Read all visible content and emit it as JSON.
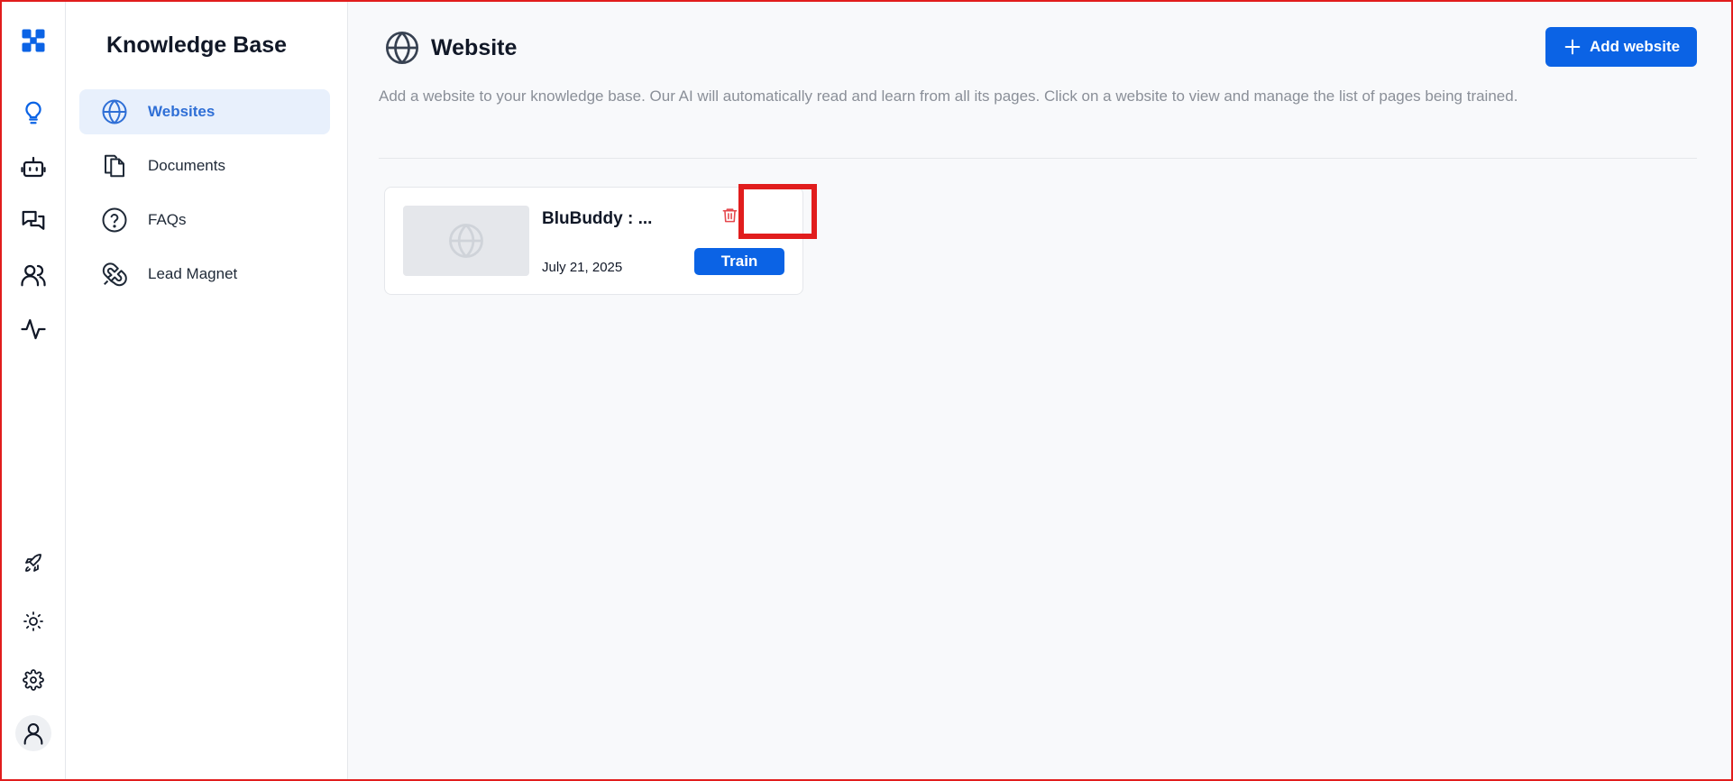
{
  "rail": {
    "icons": [
      "logo-grid-icon",
      "lightbulb-icon",
      "bot-icon",
      "chat-bubbles-icon",
      "users-icon",
      "activity-icon",
      "rocket-icon",
      "sun-icon",
      "gear-icon",
      "user-icon"
    ],
    "brand_color": "#0b63e5"
  },
  "sidebar": {
    "title": "Knowledge Base",
    "items": [
      {
        "label": "Websites",
        "icon": "globe-icon",
        "active": true
      },
      {
        "label": "Documents",
        "icon": "documents-icon",
        "active": false
      },
      {
        "label": "FAQs",
        "icon": "question-circle-icon",
        "active": false
      },
      {
        "label": "Lead Magnet",
        "icon": "magnet-icon",
        "active": false
      }
    ]
  },
  "main": {
    "title": "Website",
    "add_button_label": "Add website",
    "description": "Add a website to your knowledge base. Our AI will automatically read and learn from all its pages. Click on a website to view and manage the list of pages being trained.",
    "websites": [
      {
        "name": "BluBuddy : ...",
        "date": "July 21, 2025",
        "train_label": "Train"
      }
    ]
  },
  "colors": {
    "accent": "#0b63e5",
    "active_nav_bg": "#e8f0fc",
    "active_nav_text": "#2f6fd6",
    "delete": "#e5484d",
    "highlight_box": "#e11d1d"
  }
}
